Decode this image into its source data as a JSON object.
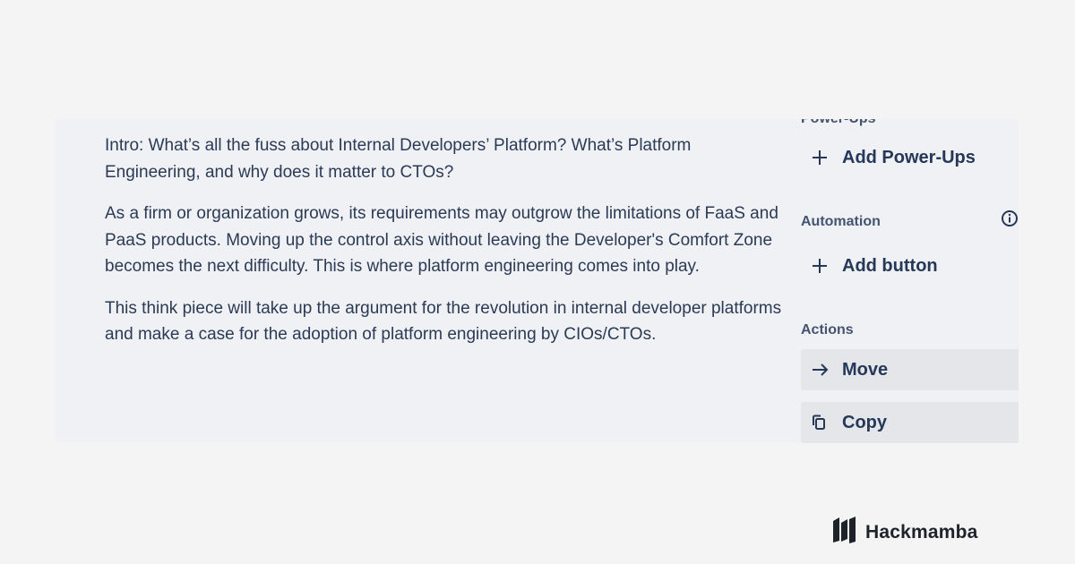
{
  "description": {
    "paragraphs": [
      "Intro: What’s all the fuss about Internal Developers’ Platform? What’s Platform Engineering, and why does it matter to CTOs?",
      "As a firm or organization grows, its requirements may outgrow the limitations of FaaS and PaaS products. Moving up the control axis without leaving the Developer's Comfort Zone becomes the next difficulty. This is where platform engineering comes into play.",
      "This think piece will take up the argument for the revolution in internal developer platforms and make a case for the adoption of platform engineering by CIOs/CTOs."
    ]
  },
  "sidebar": {
    "powerups_heading": "Power-Ups",
    "add_powerups_label": "Add Power-Ups",
    "automation_heading": "Automation",
    "add_button_label": "Add button",
    "actions_heading": "Actions",
    "move_label": "Move",
    "copy_label": "Copy"
  },
  "icons": {
    "add": "plus-icon",
    "info": "info-icon",
    "move": "arrow-right-icon",
    "copy": "copy-icon",
    "brand": "hackmamba-logo"
  },
  "brand": {
    "name": "Hackmamba"
  },
  "colors": {
    "text": "#2b3a55",
    "button_bg": "#e4e6ea",
    "card_bg": "#f0f1f4"
  }
}
